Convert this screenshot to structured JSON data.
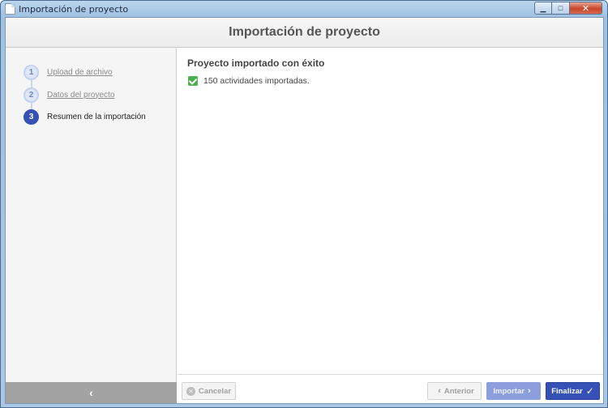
{
  "window": {
    "title": "Importación de proyecto",
    "controls": {
      "minimize": "▁",
      "maximize": "□",
      "close": "✕"
    }
  },
  "header": {
    "title": "Importación de proyecto"
  },
  "steps": [
    {
      "number": "1",
      "label": "Upload de archivo",
      "state": "done"
    },
    {
      "number": "2",
      "label": "Datos del proyecto",
      "state": "done"
    },
    {
      "number": "3",
      "label": "Resumen de la importación",
      "state": "active"
    }
  ],
  "sidebar": {
    "collapse_icon": "‹"
  },
  "main": {
    "result_title": "Proyecto importado con éxito",
    "result_text": "150 actividades importadas."
  },
  "footer": {
    "cancel_label": "Cancelar",
    "prev_label": "Anterior",
    "import_label": "Importar",
    "finish_label": "Finalizar"
  },
  "icons": {
    "cancel": "✕",
    "prev": "‹",
    "next": "›",
    "finish": "✓"
  },
  "colors": {
    "accent": "#3551b5",
    "accent_disabled": "#8c9fdc",
    "success": "#4caf50"
  }
}
